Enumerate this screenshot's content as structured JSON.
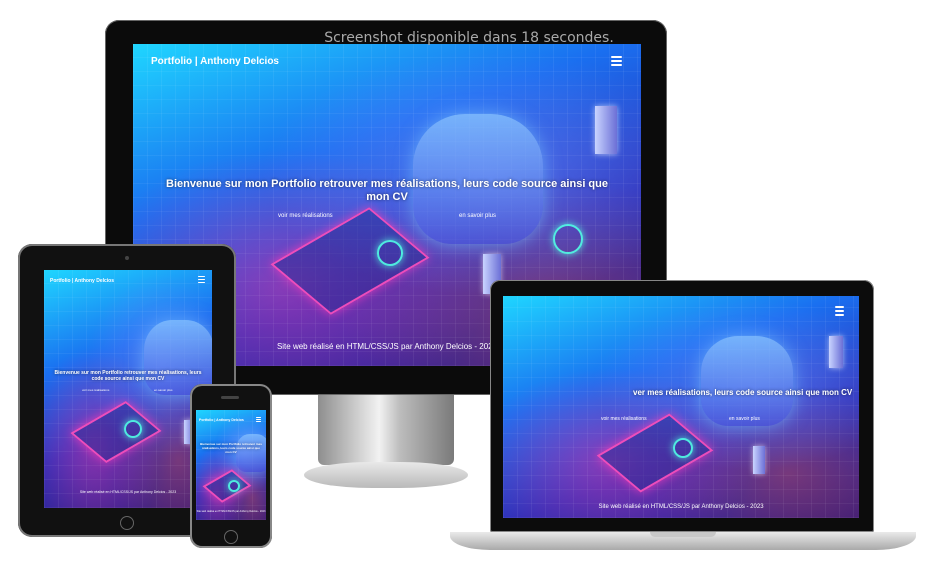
{
  "notice": "Screenshot disponible dans 18 secondes.",
  "site": {
    "title": "Portfolio | Anthony Delcios",
    "menu_icon": "hamburger-menu-icon",
    "hero_text": "Bienvenue sur mon Portfolio retrouver mes réalisations, leurs code source ainsi que mon CV",
    "link_works": "voir mes réalisations",
    "link_more": "en savoir plus",
    "footer": "Site web réalisé en HTML/CSS/JS par Anthony Delcios - 2023"
  },
  "laptop": {
    "hero_text": "ver mes réalisations, leurs code source ainsi que mon CV"
  },
  "colors": {
    "hero_top": "#1fd6ff",
    "hero_mid": "#1a6ff0",
    "hero_bottom": "#331a7a",
    "neon_pink": "#ff3cbe",
    "neon_cyan": "#50ffe6"
  }
}
